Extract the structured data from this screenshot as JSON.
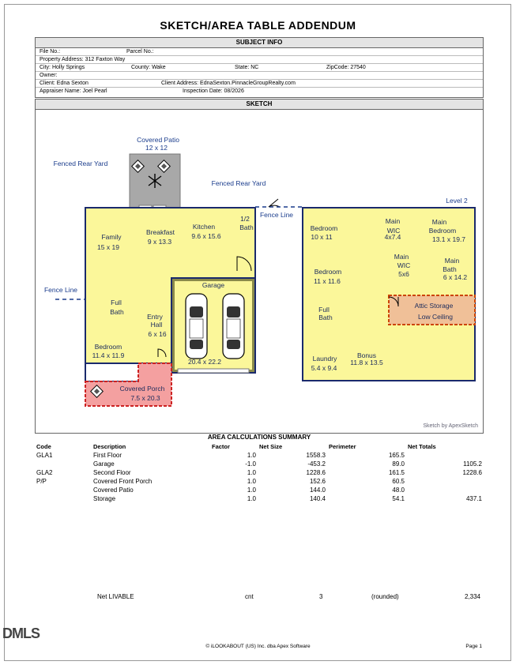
{
  "title": "SKETCH/AREA TABLE ADDENDUM",
  "subject_info": {
    "header": "SUBJECT INFO",
    "file_no": "File No.:",
    "parcel_no": "Parcel No.:",
    "property_address": "Property Address: 312 Faxton Way",
    "city": "City: Holly Springs",
    "county": "County: Wake",
    "state": "State: NC",
    "zip": "ZipCode: 27540",
    "owner": "Owner:",
    "client": "Client: Edna Sexton",
    "client_address": "Client Address: EdnaSexton.PinnacleGroupRealty.com",
    "appraiser": "Appraiser Name: Joel Pearl",
    "inspection_date": "Inspection Date: 08/2026"
  },
  "sketch": {
    "header": "SKETCH",
    "labels": {
      "covered_patio": "Covered Patio",
      "covered_patio_dim": "12 x 12",
      "fenced_rear_yard_1": "Fenced Rear Yard",
      "fenced_rear_yard_2": "Fenced Rear Yard",
      "fence_line_1": "Fence Line",
      "fence_line_2": "Fence Line",
      "family": "Family",
      "family_dim": "15 x 19",
      "breakfast": "Breakfast",
      "breakfast_dim": "9 x 13.3",
      "kitchen": "Kitchen",
      "kitchen_dim": "9.6 x 15.6",
      "half_bath_1": "1/2",
      "half_bath_2": "Bath",
      "garage": "Garage",
      "garage_dim": "20.4 x 22.2",
      "full_bath_1_a": "Full",
      "full_bath_1_b": "Bath",
      "entry_hall_a": "Entry",
      "entry_hall_b": "Hall",
      "entry_hall_dim": "6 x 16",
      "bedroom_1": "Bedroom",
      "bedroom_1_dim": "11.4 x 11.9",
      "covered_porch": "Covered Porch",
      "covered_porch_dim": "7.5 x 20.3",
      "level_2": "Level 2",
      "bedroom_2": "Bedroom",
      "bedroom_2_dim": "10 x 11",
      "wic_a": "Main",
      "wic_b": "WIC",
      "wic_dim": "4x7.4",
      "main_bedroom_a": "Main",
      "main_bedroom_b": "Bedroom",
      "main_bedroom_dim": "13.1 x 19.7",
      "bedroom_3": "Bedroom",
      "bedroom_3_dim": "11 x 11.6",
      "wic2_a": "Main",
      "wic2_b": "WIC",
      "wic2_dim": "5x6",
      "main_bath_a": "Main",
      "main_bath_b": "Bath",
      "main_bath_dim": "6 x 14.2",
      "full_bath_2_a": "Full",
      "full_bath_2_b": "Bath",
      "attic_a": "Attic Storage",
      "attic_b": "Low Ceiling",
      "laundry": "Laundry",
      "laundry_dim": "5.4 x 9.4",
      "bonus": "Bonus",
      "bonus_dim": "11.8 x 13.5"
    },
    "credit": "Sketch by ApexSketch"
  },
  "area_calc": {
    "header": "AREA CALCULATIONS SUMMARY",
    "columns": [
      "Code",
      "Description",
      "Factor",
      "Net Size",
      "Perimeter",
      "Net Totals"
    ],
    "rows": [
      [
        "GLA1",
        "First Floor",
        "1.0",
        "1558.3",
        "165.5",
        ""
      ],
      [
        "",
        "Garage",
        "-1.0",
        "-453.2",
        "89.0",
        "1105.2"
      ],
      [
        "GLA2",
        "Second Floor",
        "1.0",
        "1228.6",
        "161.5",
        "1228.6"
      ],
      [
        "P/P",
        "Covered Front Porch",
        "1.0",
        "152.6",
        "60.5",
        ""
      ],
      [
        "",
        "Covered Patio",
        "1.0",
        "144.0",
        "48.0",
        ""
      ],
      [
        "",
        "Storage",
        "1.0",
        "140.4",
        "54.1",
        "437.1"
      ]
    ],
    "net_livable": {
      "label": "Net LIVABLE",
      "unit": "cnt",
      "count": "3",
      "note": "(rounded)",
      "total": "2,334"
    }
  },
  "footer": {
    "center": "© iLOOKABOUT (US) Inc. dba Apex Software",
    "right": "Page 1",
    "watermark": "DMLS"
  },
  "colors": {
    "living": "#fbf79a",
    "garage": "#8a8a4a",
    "porch": "#f4a0a0",
    "patio": "#a8a8a8",
    "attic": "#f0c098",
    "wall": "#1a2a6c"
  }
}
